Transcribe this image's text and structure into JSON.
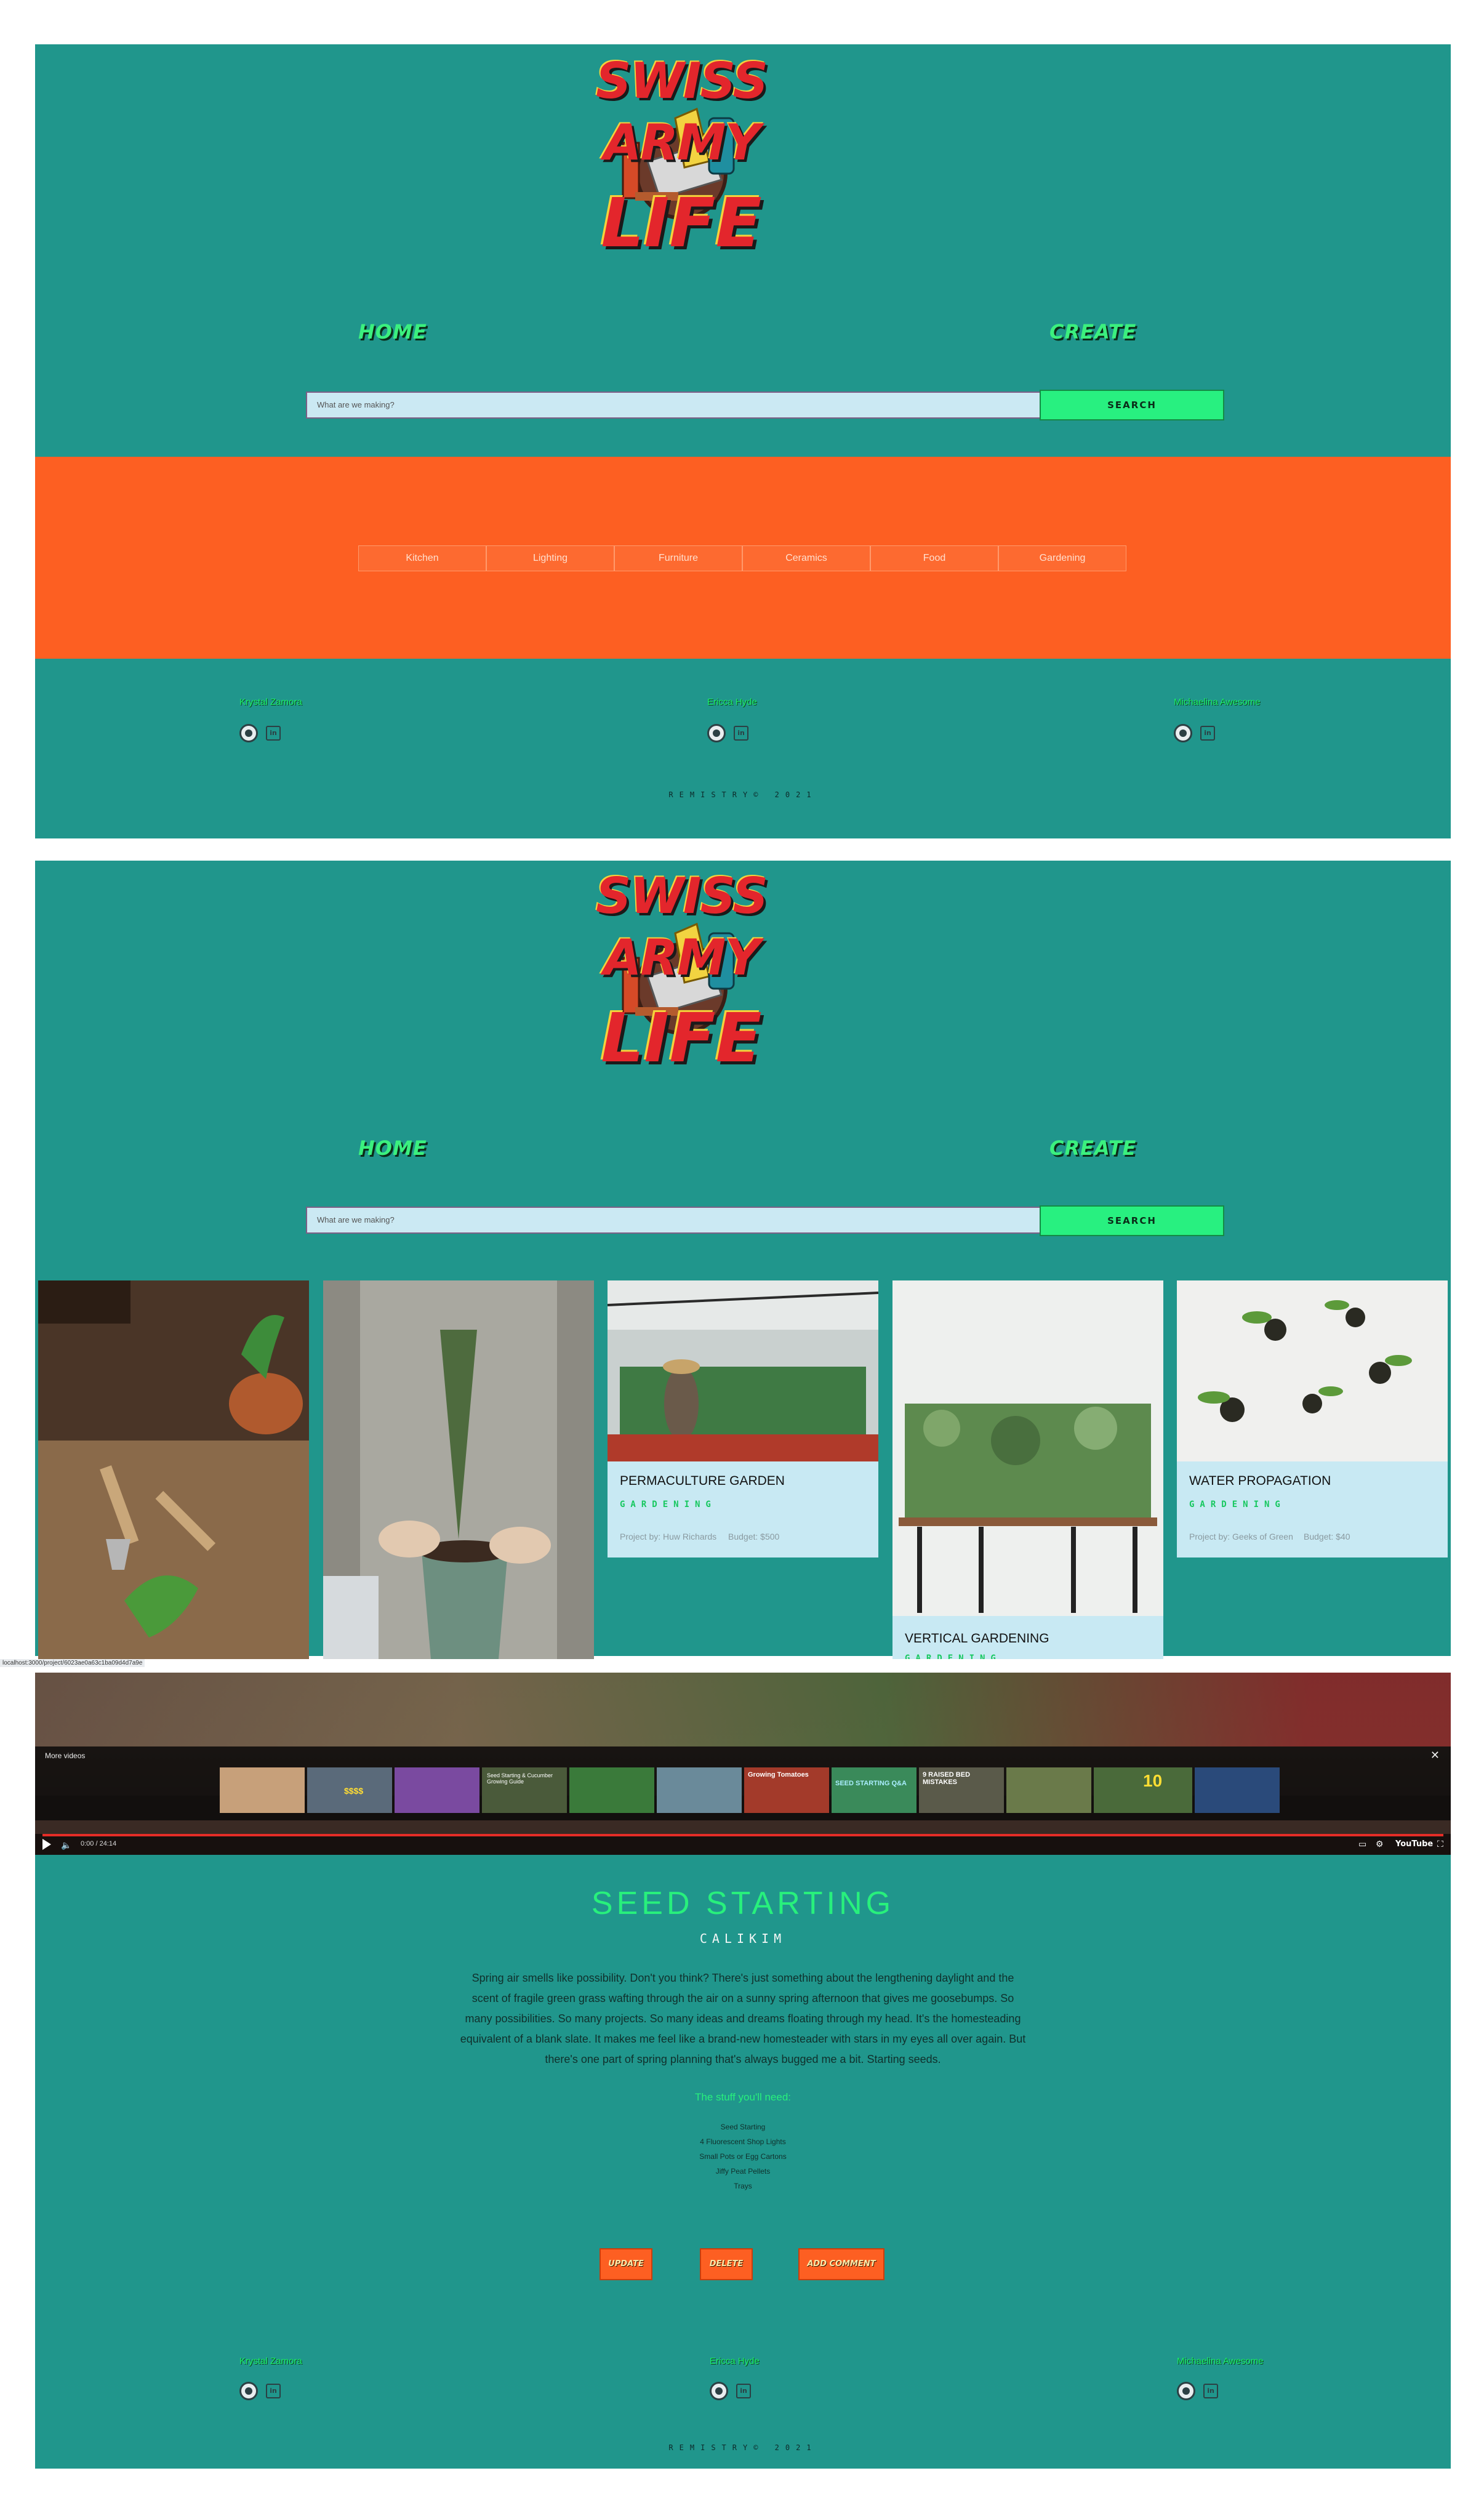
{
  "logo": {
    "line1": "SWISS ARMY",
    "line2": "LIFE"
  },
  "nav": {
    "home": "HOME",
    "create": "CREATE"
  },
  "search": {
    "placeholder": "What are we making?",
    "button": "SEARCH"
  },
  "categories": [
    "Kitchen",
    "Lighting",
    "Furniture",
    "Ceramics",
    "Food",
    "Gardening"
  ],
  "footer": {
    "members": [
      "Krystal Zamora",
      "Ericca Hyde",
      "Michaelina Awesome"
    ],
    "copyright": "REMISTRY© 2021"
  },
  "cards": [
    {
      "title": "",
      "category": ""
    },
    {
      "title": "",
      "category": ""
    },
    {
      "title": "PERMACULTURE GARDEN",
      "category": "GARDENING",
      "project_by": "Project by: Huw Richards",
      "budget": "Budget: $500"
    },
    {
      "title": "VERTICAL GARDENING",
      "category": "GARDENING"
    },
    {
      "title": "WATER PROPAGATION",
      "category": "GARDENING",
      "project_by": "Project by: Geeks of Green",
      "budget": "Budget: $40"
    }
  ],
  "status_url": "localhost:3000/project/6023ae0a63c1ba09d4d7a9e",
  "video": {
    "more_label": "More videos",
    "time": "0:00 / 24:14",
    "brand": "YouTube",
    "thumb_texts": [
      "$$$$",
      "Seed Starting & Cucumber Growing Guide",
      "Growing Tomatoes",
      "SEED STARTING Q&A",
      "9 RAISED BED MISTAKES",
      "10"
    ]
  },
  "project": {
    "title": "SEED STARTING",
    "author": "CALIKIM",
    "description": "Spring air smells like possibility. Don't you think? There's just something about the lengthening daylight and the scent of fragile green grass wafting through the air on a sunny spring afternoon that gives me goosebumps. So many possibilities. So many projects. So many ideas and dreams floating through my head. It's the homesteading equivalent of a blank slate. It makes me feel like a brand-new homesteader with stars in my eyes all over again. But there's one part of spring planning that's always bugged me a bit. Starting seeds.",
    "needs_label": "The stuff you'll need:",
    "materials": [
      "Seed Starting",
      "4 Fluorescent Shop Lights",
      "Small Pots or Egg Cartons",
      "Jiffy Peat Pellets",
      "Trays"
    ],
    "actions": {
      "update": "UPDATE",
      "delete": "DELETE",
      "comment": "ADD COMMENT"
    }
  },
  "colors": {
    "teal": "#20968c",
    "orange": "#fd5f22",
    "green": "#28f080",
    "light_blue": "#c8e9f3"
  }
}
